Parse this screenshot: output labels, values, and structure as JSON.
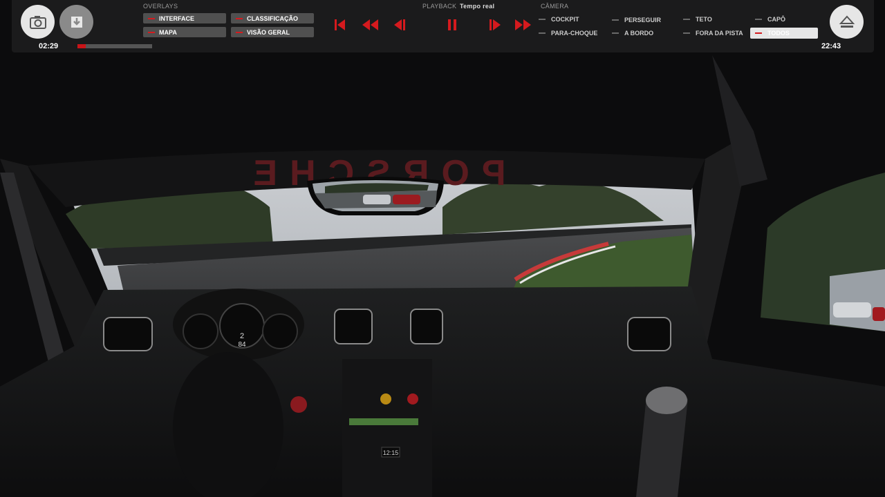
{
  "hud": {
    "screenshot_icon": "camera-icon",
    "save_icon": "download-icon",
    "eject_icon": "eject-icon",
    "elapsed_time": "02:29",
    "total_time": "22:43",
    "progress": 0.11,
    "overlays": {
      "heading": "OVERLAYS",
      "items": [
        "INTERFACE",
        "CLASSIFICAÇÃO",
        "MAPA",
        "VISÃO GERAL"
      ]
    },
    "playback": {
      "heading": "PLAYBACK",
      "mode": "Tempo real",
      "controls": [
        "skip-to-start-icon",
        "rewind-icon",
        "step-back-icon",
        "pause-icon",
        "step-forward-icon",
        "fast-forward-icon"
      ]
    },
    "camera": {
      "heading": "CÂMERA",
      "items": [
        "COCKPIT",
        "PERSEGUIR",
        "TETO",
        "CAPÔ",
        "PARA-CHOQUE",
        "A BORDO",
        "FORA DA PISTA",
        "TODOS"
      ],
      "active": "TODOS"
    }
  },
  "scene": {
    "windshield_banner": "PORSCHE",
    "display_gear": "2",
    "display_speed": "84",
    "clock_display": "12:15"
  },
  "colors": {
    "accent": "#d51a1e",
    "panel": "#1b1b1c"
  }
}
